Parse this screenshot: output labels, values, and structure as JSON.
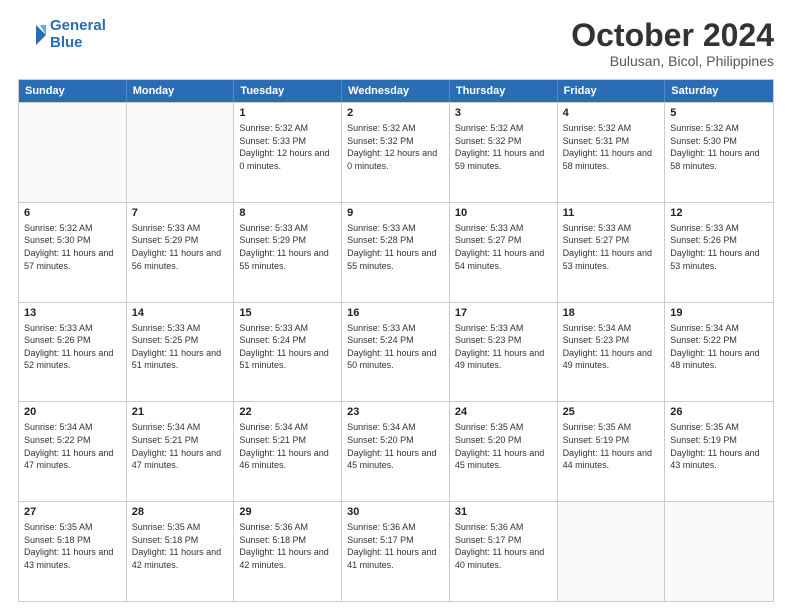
{
  "logo": {
    "line1": "General",
    "line2": "Blue"
  },
  "header": {
    "month": "October 2024",
    "location": "Bulusan, Bicol, Philippines"
  },
  "weekdays": [
    "Sunday",
    "Monday",
    "Tuesday",
    "Wednesday",
    "Thursday",
    "Friday",
    "Saturday"
  ],
  "rows": [
    [
      {
        "day": "",
        "sunrise": "",
        "sunset": "",
        "daylight": ""
      },
      {
        "day": "",
        "sunrise": "",
        "sunset": "",
        "daylight": ""
      },
      {
        "day": "1",
        "sunrise": "Sunrise: 5:32 AM",
        "sunset": "Sunset: 5:33 PM",
        "daylight": "Daylight: 12 hours and 0 minutes."
      },
      {
        "day": "2",
        "sunrise": "Sunrise: 5:32 AM",
        "sunset": "Sunset: 5:32 PM",
        "daylight": "Daylight: 12 hours and 0 minutes."
      },
      {
        "day": "3",
        "sunrise": "Sunrise: 5:32 AM",
        "sunset": "Sunset: 5:32 PM",
        "daylight": "Daylight: 11 hours and 59 minutes."
      },
      {
        "day": "4",
        "sunrise": "Sunrise: 5:32 AM",
        "sunset": "Sunset: 5:31 PM",
        "daylight": "Daylight: 11 hours and 58 minutes."
      },
      {
        "day": "5",
        "sunrise": "Sunrise: 5:32 AM",
        "sunset": "Sunset: 5:30 PM",
        "daylight": "Daylight: 11 hours and 58 minutes."
      }
    ],
    [
      {
        "day": "6",
        "sunrise": "Sunrise: 5:32 AM",
        "sunset": "Sunset: 5:30 PM",
        "daylight": "Daylight: 11 hours and 57 minutes."
      },
      {
        "day": "7",
        "sunrise": "Sunrise: 5:33 AM",
        "sunset": "Sunset: 5:29 PM",
        "daylight": "Daylight: 11 hours and 56 minutes."
      },
      {
        "day": "8",
        "sunrise": "Sunrise: 5:33 AM",
        "sunset": "Sunset: 5:29 PM",
        "daylight": "Daylight: 11 hours and 55 minutes."
      },
      {
        "day": "9",
        "sunrise": "Sunrise: 5:33 AM",
        "sunset": "Sunset: 5:28 PM",
        "daylight": "Daylight: 11 hours and 55 minutes."
      },
      {
        "day": "10",
        "sunrise": "Sunrise: 5:33 AM",
        "sunset": "Sunset: 5:27 PM",
        "daylight": "Daylight: 11 hours and 54 minutes."
      },
      {
        "day": "11",
        "sunrise": "Sunrise: 5:33 AM",
        "sunset": "Sunset: 5:27 PM",
        "daylight": "Daylight: 11 hours and 53 minutes."
      },
      {
        "day": "12",
        "sunrise": "Sunrise: 5:33 AM",
        "sunset": "Sunset: 5:26 PM",
        "daylight": "Daylight: 11 hours and 53 minutes."
      }
    ],
    [
      {
        "day": "13",
        "sunrise": "Sunrise: 5:33 AM",
        "sunset": "Sunset: 5:26 PM",
        "daylight": "Daylight: 11 hours and 52 minutes."
      },
      {
        "day": "14",
        "sunrise": "Sunrise: 5:33 AM",
        "sunset": "Sunset: 5:25 PM",
        "daylight": "Daylight: 11 hours and 51 minutes."
      },
      {
        "day": "15",
        "sunrise": "Sunrise: 5:33 AM",
        "sunset": "Sunset: 5:24 PM",
        "daylight": "Daylight: 11 hours and 51 minutes."
      },
      {
        "day": "16",
        "sunrise": "Sunrise: 5:33 AM",
        "sunset": "Sunset: 5:24 PM",
        "daylight": "Daylight: 11 hours and 50 minutes."
      },
      {
        "day": "17",
        "sunrise": "Sunrise: 5:33 AM",
        "sunset": "Sunset: 5:23 PM",
        "daylight": "Daylight: 11 hours and 49 minutes."
      },
      {
        "day": "18",
        "sunrise": "Sunrise: 5:34 AM",
        "sunset": "Sunset: 5:23 PM",
        "daylight": "Daylight: 11 hours and 49 minutes."
      },
      {
        "day": "19",
        "sunrise": "Sunrise: 5:34 AM",
        "sunset": "Sunset: 5:22 PM",
        "daylight": "Daylight: 11 hours and 48 minutes."
      }
    ],
    [
      {
        "day": "20",
        "sunrise": "Sunrise: 5:34 AM",
        "sunset": "Sunset: 5:22 PM",
        "daylight": "Daylight: 11 hours and 47 minutes."
      },
      {
        "day": "21",
        "sunrise": "Sunrise: 5:34 AM",
        "sunset": "Sunset: 5:21 PM",
        "daylight": "Daylight: 11 hours and 47 minutes."
      },
      {
        "day": "22",
        "sunrise": "Sunrise: 5:34 AM",
        "sunset": "Sunset: 5:21 PM",
        "daylight": "Daylight: 11 hours and 46 minutes."
      },
      {
        "day": "23",
        "sunrise": "Sunrise: 5:34 AM",
        "sunset": "Sunset: 5:20 PM",
        "daylight": "Daylight: 11 hours and 45 minutes."
      },
      {
        "day": "24",
        "sunrise": "Sunrise: 5:35 AM",
        "sunset": "Sunset: 5:20 PM",
        "daylight": "Daylight: 11 hours and 45 minutes."
      },
      {
        "day": "25",
        "sunrise": "Sunrise: 5:35 AM",
        "sunset": "Sunset: 5:19 PM",
        "daylight": "Daylight: 11 hours and 44 minutes."
      },
      {
        "day": "26",
        "sunrise": "Sunrise: 5:35 AM",
        "sunset": "Sunset: 5:19 PM",
        "daylight": "Daylight: 11 hours and 43 minutes."
      }
    ],
    [
      {
        "day": "27",
        "sunrise": "Sunrise: 5:35 AM",
        "sunset": "Sunset: 5:18 PM",
        "daylight": "Daylight: 11 hours and 43 minutes."
      },
      {
        "day": "28",
        "sunrise": "Sunrise: 5:35 AM",
        "sunset": "Sunset: 5:18 PM",
        "daylight": "Daylight: 11 hours and 42 minutes."
      },
      {
        "day": "29",
        "sunrise": "Sunrise: 5:36 AM",
        "sunset": "Sunset: 5:18 PM",
        "daylight": "Daylight: 11 hours and 42 minutes."
      },
      {
        "day": "30",
        "sunrise": "Sunrise: 5:36 AM",
        "sunset": "Sunset: 5:17 PM",
        "daylight": "Daylight: 11 hours and 41 minutes."
      },
      {
        "day": "31",
        "sunrise": "Sunrise: 5:36 AM",
        "sunset": "Sunset: 5:17 PM",
        "daylight": "Daylight: 11 hours and 40 minutes."
      },
      {
        "day": "",
        "sunrise": "",
        "sunset": "",
        "daylight": ""
      },
      {
        "day": "",
        "sunrise": "",
        "sunset": "",
        "daylight": ""
      }
    ]
  ]
}
